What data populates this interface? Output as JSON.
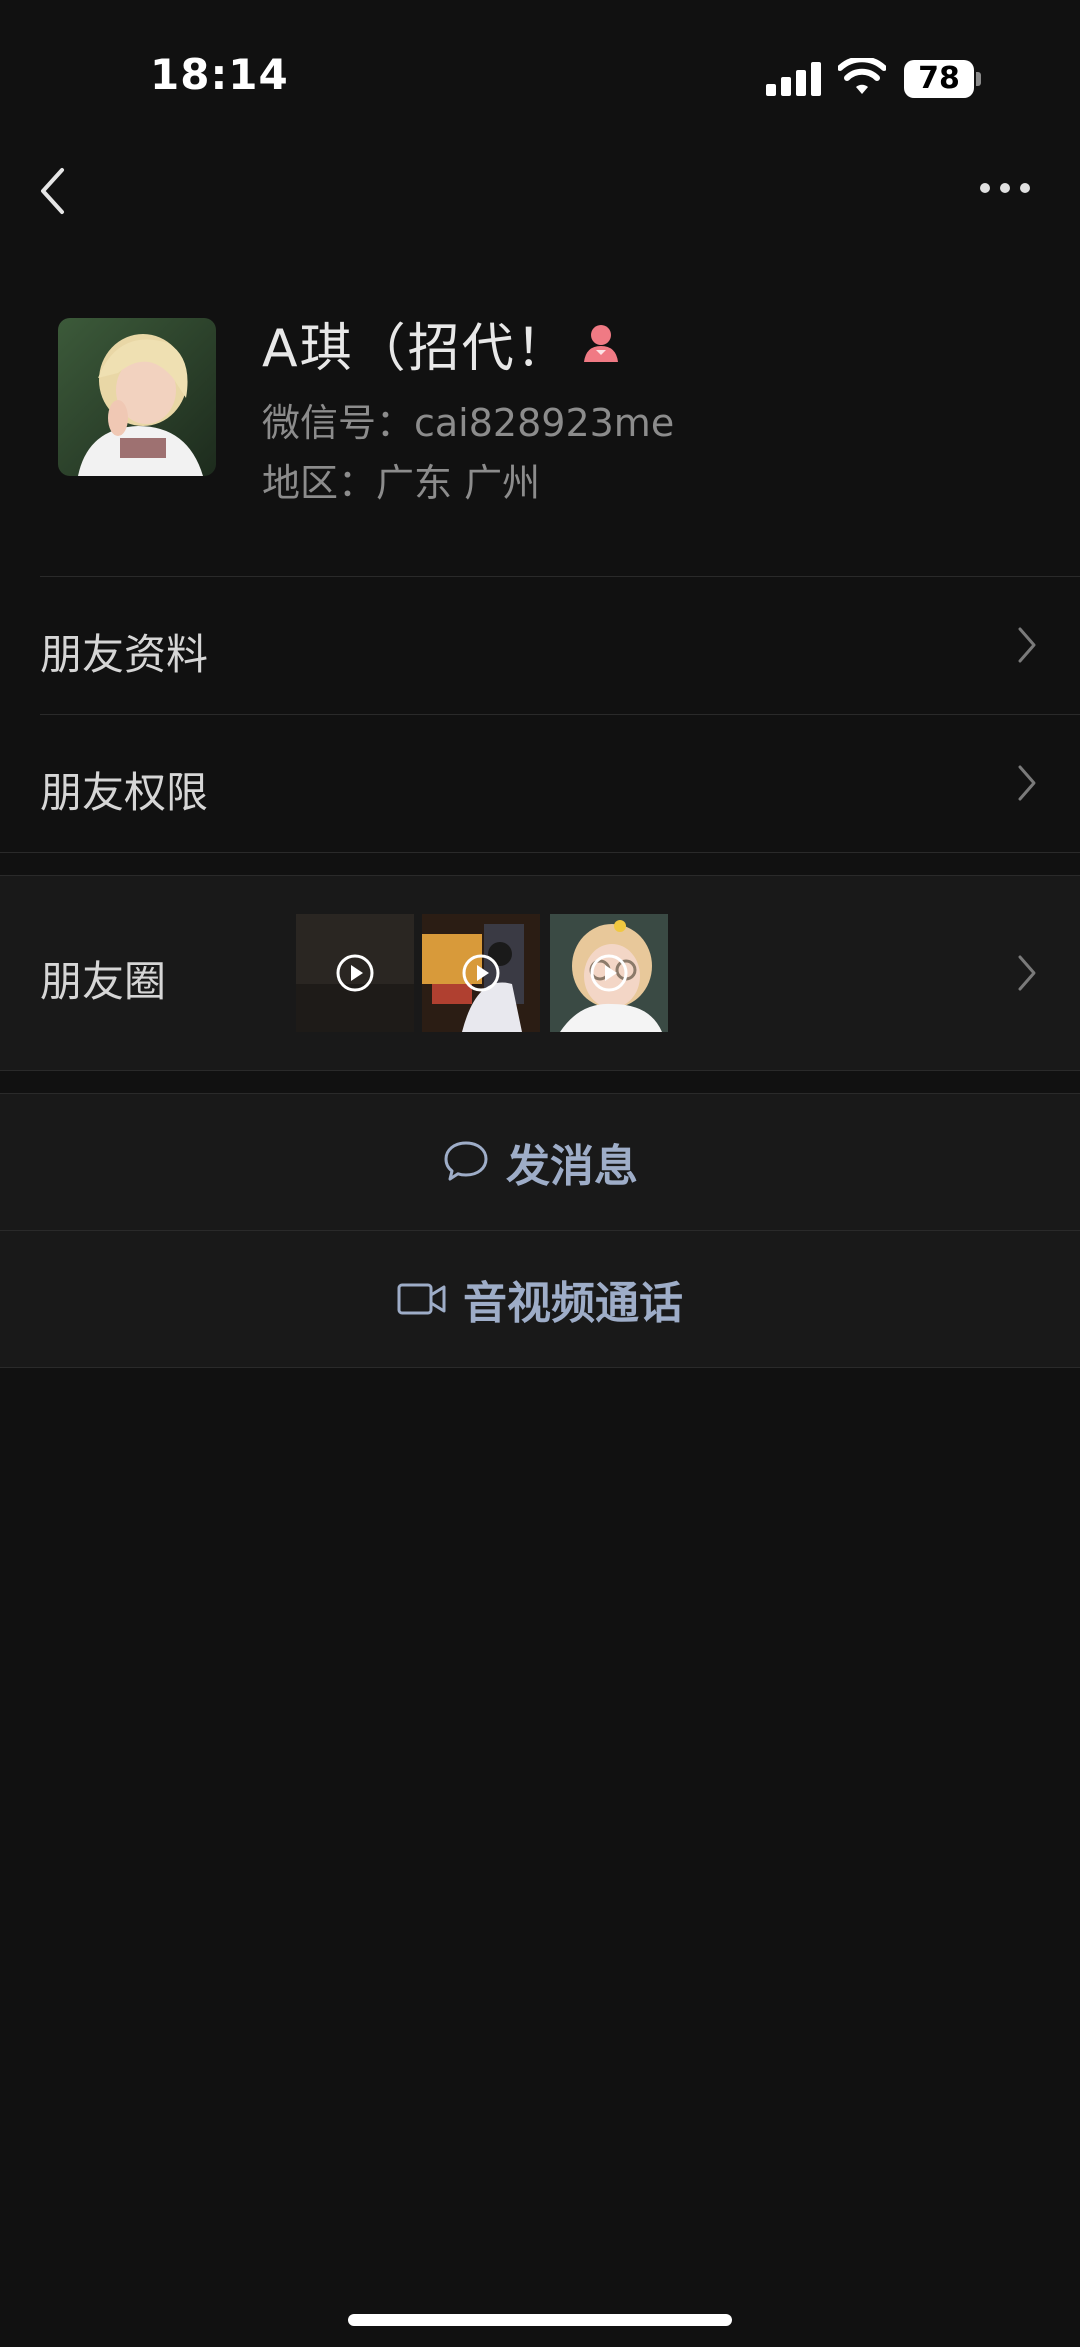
{
  "status_bar": {
    "time": "18:14",
    "battery": "78"
  },
  "nav": {
    "back_icon": "chevron-left-icon",
    "more_icon": "ellipsis-icon"
  },
  "profile": {
    "name": "A琪（招代！",
    "gender_icon": "female-icon",
    "wechat_id": "微信号：cai828923me",
    "region": "地区：广东 广州"
  },
  "menu": {
    "friend_profile": "朋友资料",
    "friend_permissions": "朋友权限",
    "moments": "朋友圈"
  },
  "actions": {
    "send_message": "发消息",
    "av_call": "音视频通话"
  },
  "colors": {
    "background": "#111111",
    "section": "#191919",
    "accent_text": "#9eadc8",
    "female_badge": "#f07a84"
  }
}
